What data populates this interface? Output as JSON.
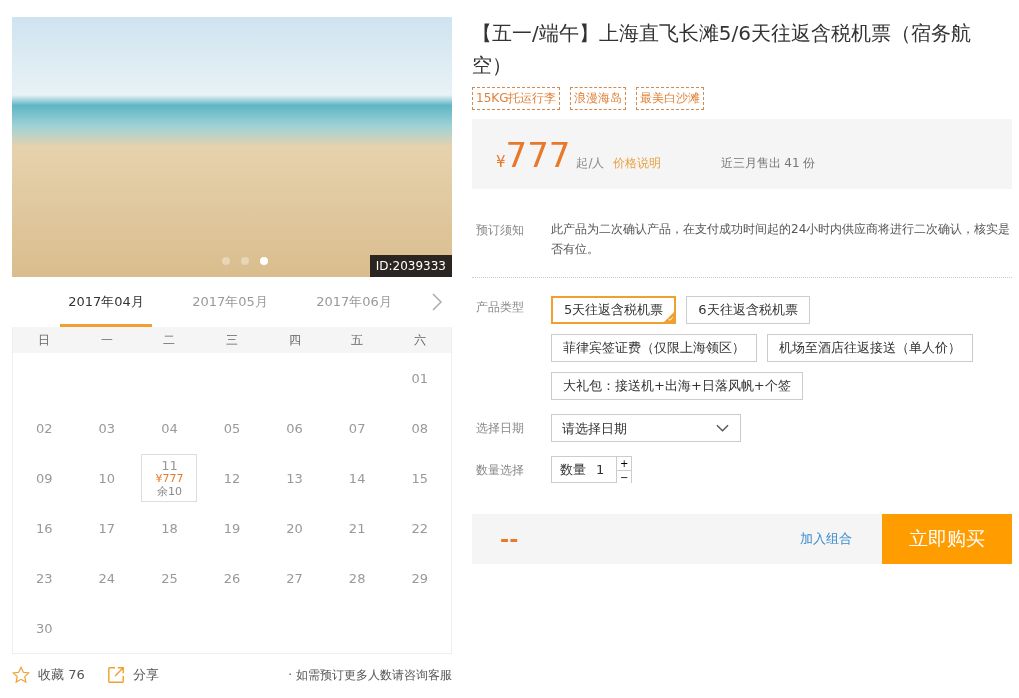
{
  "gallery": {
    "id_badge": "ID:2039333",
    "dots": [
      {
        "selected": false
      },
      {
        "selected": false
      },
      {
        "selected": true
      }
    ]
  },
  "calendar": {
    "months": [
      {
        "label": "2017年04月",
        "selected": true
      },
      {
        "label": "2017年05月",
        "selected": false
      },
      {
        "label": "2017年06月",
        "selected": false
      }
    ],
    "weekdays": [
      "日",
      "一",
      "二",
      "三",
      "四",
      "五",
      "六"
    ],
    "weeks": [
      [
        {
          "kind": "blank"
        },
        {
          "kind": "blank"
        },
        {
          "kind": "blank"
        },
        {
          "kind": "blank"
        },
        {
          "kind": "blank"
        },
        {
          "kind": "blank"
        },
        {
          "day": "01"
        }
      ],
      [
        {
          "day": "02"
        },
        {
          "day": "03"
        },
        {
          "day": "04"
        },
        {
          "day": "05"
        },
        {
          "day": "06"
        },
        {
          "day": "07"
        },
        {
          "day": "08"
        }
      ],
      [
        {
          "day": "09"
        },
        {
          "day": "10"
        },
        {
          "day": "11",
          "price": "¥777",
          "remaining": "余10"
        },
        {
          "day": "12"
        },
        {
          "day": "13"
        },
        {
          "day": "14"
        },
        {
          "day": "15"
        }
      ],
      [
        {
          "day": "16"
        },
        {
          "day": "17"
        },
        {
          "day": "18"
        },
        {
          "day": "19"
        },
        {
          "day": "20"
        },
        {
          "day": "21"
        },
        {
          "day": "22"
        }
      ],
      [
        {
          "day": "23"
        },
        {
          "day": "24"
        },
        {
          "day": "25"
        },
        {
          "day": "26"
        },
        {
          "day": "27"
        },
        {
          "day": "28"
        },
        {
          "day": "29"
        }
      ],
      [
        {
          "day": "30"
        }
      ]
    ]
  },
  "footer": {
    "favorite": "收藏 76",
    "share": "分享",
    "note": "· 如需预订更多人数请咨询客服"
  },
  "product": {
    "title": "【五一/端午】上海直飞长滩5/6天往返含税机票（宿务航空）",
    "tags": [
      "15KG托运行李",
      "浪漫海岛",
      "最美白沙滩"
    ],
    "price": {
      "currency": "¥",
      "amount": "777",
      "unit": "起/人",
      "info_link": "价格说明",
      "sold": "近三月售出 41 份"
    },
    "notice": {
      "label": "预订须知",
      "text": "此产品为二次确认产品，在支付成功时间起的24小时内供应商将进行二次确认，核实是否有位。"
    },
    "types": {
      "label": "产品类型",
      "options": [
        {
          "label": "5天往返含税机票",
          "selected": true
        },
        {
          "label": "6天往返含税机票",
          "selected": false
        },
        {
          "label": "菲律宾签证费（仅限上海领区）",
          "selected": false
        },
        {
          "label": "机场至酒店往返接送（单人价）",
          "selected": false
        },
        {
          "label": "大礼包：接送机+出海+日落风帆+个签",
          "selected": false
        }
      ]
    },
    "date": {
      "label": "选择日期",
      "placeholder": "请选择日期"
    },
    "quantity": {
      "label": "数量选择",
      "prefix": "数量",
      "value": "1",
      "plus": "+",
      "minus": "−"
    },
    "total": "--",
    "add_combo": "加入组合",
    "buy": "立即购买"
  }
}
